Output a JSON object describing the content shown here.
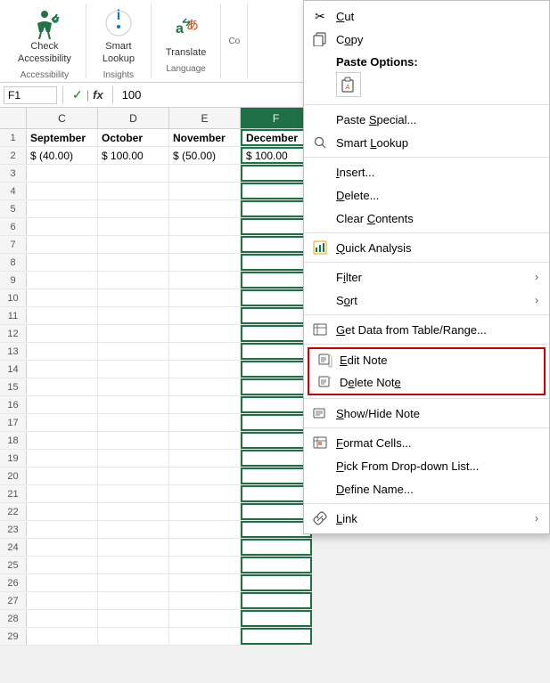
{
  "ribbon": {
    "groups": [
      {
        "name": "Accessibility",
        "label": "Accessibility",
        "buttons": [
          {
            "id": "check-accessibility",
            "label": "Check\nAccessibility",
            "icon": "♿"
          }
        ]
      },
      {
        "name": "Insights",
        "label": "Insights",
        "buttons": [
          {
            "id": "smart-lookup",
            "label": "Smart\nLookup",
            "icon": "🔍"
          }
        ]
      },
      {
        "name": "Language",
        "label": "Language",
        "buttons": [
          {
            "id": "translate",
            "label": "Translate",
            "icon": "🔤"
          }
        ]
      }
    ]
  },
  "formula_bar": {
    "cell_ref": "F1",
    "formula_value": "100"
  },
  "spreadsheet": {
    "columns": [
      "C",
      "D",
      "E",
      "F"
    ],
    "header_row": {
      "c": "September",
      "d": "October",
      "e": "November",
      "f": "December"
    },
    "data_row": {
      "c": "$ (40.00)",
      "d": "$ 100.00",
      "e": "$ (50.00)",
      "f": "$ 100.00"
    }
  },
  "context_menu": {
    "items": [
      {
        "id": "cut",
        "label": "Cut",
        "icon": "✂",
        "shortcut_char": "C",
        "has_arrow": false,
        "highlighted": false,
        "is_separator": false,
        "bold": false,
        "is_paste_options": false
      },
      {
        "id": "copy",
        "label": "Copy",
        "icon": "📋",
        "shortcut_char": "o",
        "has_arrow": false,
        "highlighted": false,
        "is_separator": false,
        "bold": false,
        "is_paste_options": false
      },
      {
        "id": "paste-options-header",
        "label": "Paste Options:",
        "icon": "",
        "has_arrow": false,
        "highlighted": false,
        "is_separator": false,
        "bold": true,
        "is_paste_options": true
      },
      {
        "id": "sep1",
        "is_separator": true
      },
      {
        "id": "paste-special",
        "label": "Paste Special...",
        "icon": "",
        "shortcut_char": "S",
        "has_arrow": false,
        "highlighted": false,
        "is_separator": false,
        "bold": false,
        "is_paste_options": false
      },
      {
        "id": "smart-lookup",
        "label": "Smart Lookup",
        "icon": "🔍",
        "shortcut_char": "L",
        "has_arrow": false,
        "highlighted": false,
        "is_separator": false,
        "bold": false,
        "is_paste_options": false
      },
      {
        "id": "sep2",
        "is_separator": true
      },
      {
        "id": "insert",
        "label": "Insert...",
        "icon": "",
        "shortcut_char": "I",
        "has_arrow": false,
        "highlighted": false,
        "is_separator": false,
        "bold": false,
        "is_paste_options": false
      },
      {
        "id": "delete",
        "label": "Delete...",
        "icon": "",
        "shortcut_char": "D",
        "has_arrow": false,
        "highlighted": false,
        "is_separator": false,
        "bold": false,
        "is_paste_options": false
      },
      {
        "id": "clear-contents",
        "label": "Clear Contents",
        "icon": "",
        "shortcut_char": "C",
        "has_arrow": false,
        "highlighted": false,
        "is_separator": false,
        "bold": false,
        "is_paste_options": false
      },
      {
        "id": "sep3",
        "is_separator": true
      },
      {
        "id": "quick-analysis",
        "label": "Quick Analysis",
        "icon": "📊",
        "shortcut_char": "Q",
        "has_arrow": false,
        "highlighted": false,
        "is_separator": false,
        "bold": false,
        "is_paste_options": false
      },
      {
        "id": "sep4",
        "is_separator": true
      },
      {
        "id": "filter",
        "label": "Filter",
        "icon": "",
        "shortcut_char": "i",
        "has_arrow": true,
        "highlighted": false,
        "is_separator": false,
        "bold": false,
        "is_paste_options": false
      },
      {
        "id": "sort",
        "label": "Sort",
        "icon": "",
        "shortcut_char": "o",
        "has_arrow": true,
        "highlighted": false,
        "is_separator": false,
        "bold": false,
        "is_paste_options": false
      },
      {
        "id": "sep5",
        "is_separator": true
      },
      {
        "id": "get-data",
        "label": "Get Data from Table/Range...",
        "icon": "📋",
        "shortcut_char": "G",
        "has_arrow": false,
        "highlighted": false,
        "is_separator": false,
        "bold": false,
        "is_paste_options": false
      },
      {
        "id": "sep6",
        "is_separator": true
      },
      {
        "id": "edit-note",
        "label": "Edit Note",
        "icon": "📝",
        "shortcut_char": "E",
        "has_arrow": false,
        "highlighted": true,
        "is_separator": false,
        "bold": false,
        "is_paste_options": false
      },
      {
        "id": "delete-note",
        "label": "Delete Note",
        "icon": "📝",
        "shortcut_char": "e",
        "has_arrow": false,
        "highlighted": true,
        "is_separator": false,
        "bold": false,
        "is_paste_options": false
      },
      {
        "id": "sep7",
        "is_separator": true
      },
      {
        "id": "show-hide-note",
        "label": "Show/Hide Note",
        "icon": "🗒",
        "shortcut_char": "S",
        "has_arrow": false,
        "highlighted": false,
        "is_separator": false,
        "bold": false,
        "is_paste_options": false
      },
      {
        "id": "sep8",
        "is_separator": true
      },
      {
        "id": "format-cells",
        "label": "Format Cells...",
        "icon": "📋",
        "shortcut_char": "F",
        "has_arrow": false,
        "highlighted": false,
        "is_separator": false,
        "bold": false,
        "is_paste_options": false
      },
      {
        "id": "pick-from-dropdown",
        "label": "Pick From Drop-down List...",
        "icon": "",
        "shortcut_char": "P",
        "has_arrow": false,
        "highlighted": false,
        "is_separator": false,
        "bold": false,
        "is_paste_options": false
      },
      {
        "id": "define-name",
        "label": "Define Name...",
        "icon": "",
        "shortcut_char": "D",
        "has_arrow": false,
        "highlighted": false,
        "is_separator": false,
        "bold": false,
        "is_paste_options": false
      },
      {
        "id": "sep9",
        "is_separator": true
      },
      {
        "id": "link",
        "label": "Link",
        "icon": "🔗",
        "shortcut_char": "L",
        "has_arrow": true,
        "highlighted": false,
        "is_separator": false,
        "bold": false,
        "is_paste_options": false
      }
    ]
  }
}
